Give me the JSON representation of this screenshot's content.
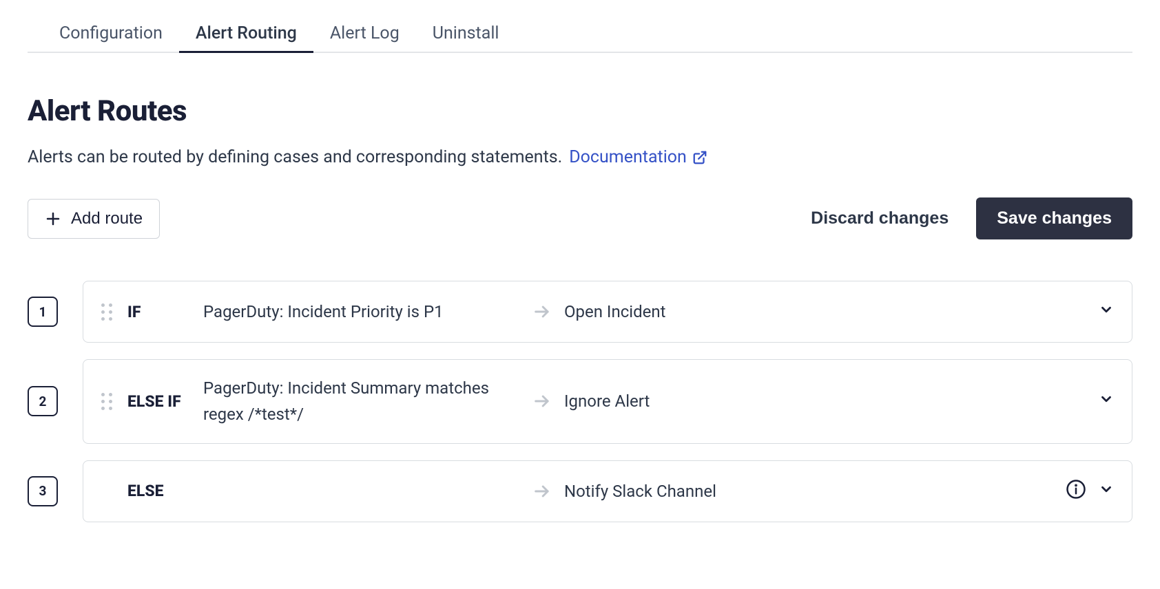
{
  "tabs": {
    "items": [
      {
        "label": "Configuration",
        "active": false
      },
      {
        "label": "Alert Routing",
        "active": true
      },
      {
        "label": "Alert Log",
        "active": false
      },
      {
        "label": "Uninstall",
        "active": false
      }
    ]
  },
  "page": {
    "title": "Alert Routes",
    "description": "Alerts can be routed by defining cases and corresponding statements.",
    "doc_link_label": "Documentation"
  },
  "actions": {
    "add_route_label": "Add route",
    "discard_label": "Discard changes",
    "save_label": "Save changes"
  },
  "routes": [
    {
      "number": "1",
      "keyword": "IF",
      "condition": "PagerDuty: Incident Priority is P1",
      "action": "Open Incident",
      "draggable": true,
      "has_info": false
    },
    {
      "number": "2",
      "keyword": "ELSE IF",
      "condition": "PagerDuty: Incident Summary matches regex /*test*/",
      "action": "Ignore Alert",
      "draggable": true,
      "has_info": false
    },
    {
      "number": "3",
      "keyword": "ELSE",
      "condition": "",
      "action": "Notify Slack Channel",
      "draggable": false,
      "has_info": true
    }
  ]
}
